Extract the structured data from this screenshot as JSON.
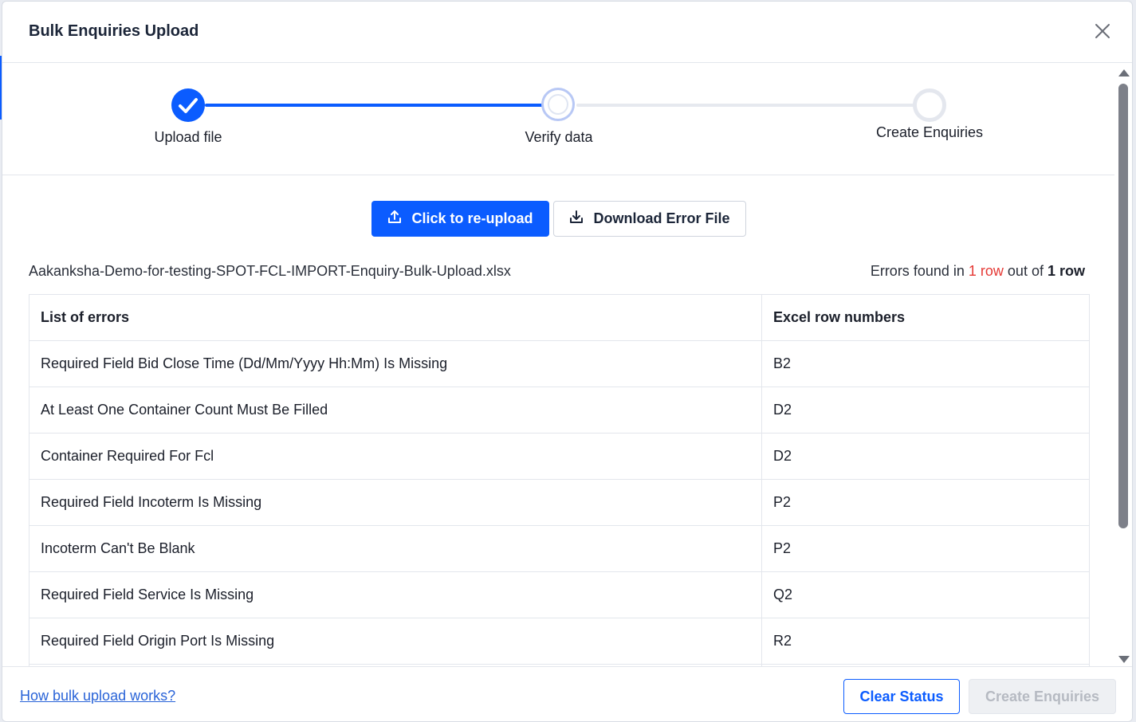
{
  "modal": {
    "title": "Bulk Enquiries Upload"
  },
  "stepper": {
    "steps": [
      {
        "label": "Upload file",
        "state": "done"
      },
      {
        "label": "Verify data",
        "state": "active"
      },
      {
        "label": "Create Enquiries",
        "state": "pending"
      }
    ]
  },
  "actions": {
    "reupload_label": "Click to re-upload",
    "download_label": "Download Error File"
  },
  "file": {
    "name": "Aakanksha-Demo-for-testing-SPOT-FCL-IMPORT-Enquiry-Bulk-Upload.xlsx"
  },
  "summary": {
    "prefix": "Errors found in",
    "error_rows": "1 row",
    "middle": "out of",
    "total_rows": "1 row"
  },
  "table": {
    "headers": [
      "List of errors",
      "Excel row numbers"
    ],
    "rows": [
      [
        "Required Field Bid Close Time (Dd/Mm/Yyyy Hh:Mm) Is Missing",
        "B2"
      ],
      [
        "At Least One Container Count Must Be Filled",
        "D2"
      ],
      [
        "Container Required For Fcl",
        "D2"
      ],
      [
        "Required Field Incoterm Is Missing",
        "P2"
      ],
      [
        "Incoterm Can't Be Blank",
        "P2"
      ],
      [
        "Required Field Service Is Missing",
        "Q2"
      ],
      [
        "Required Field Origin Port Is Missing",
        "R2"
      ]
    ]
  },
  "footer": {
    "help_link": "How bulk upload works?",
    "clear_label": "Clear Status",
    "create_label": "Create Enquiries"
  },
  "colors": {
    "primary": "#0b5cff",
    "error": "#e53935",
    "link": "#2a64d8",
    "disabled_text": "#b6bac2"
  }
}
